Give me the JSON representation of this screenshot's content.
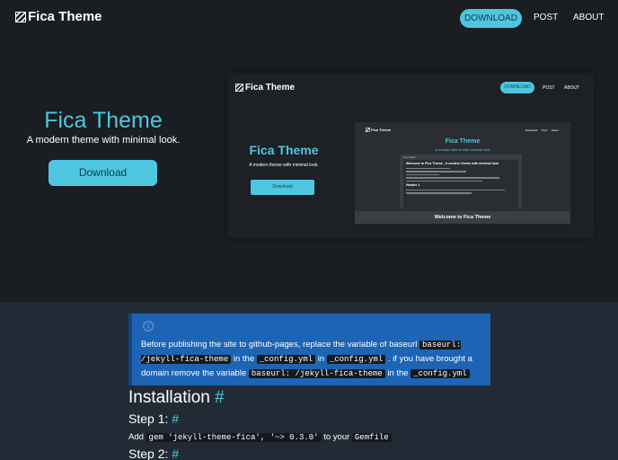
{
  "colors": {
    "accent": "#4fc6e0",
    "page_bg": "#1a1d21",
    "content_bg": "#222b35",
    "alert_bg": "#1d64b5",
    "code_bg": "#15191e"
  },
  "navbar": {
    "logo_icon": "striped-square-logo-icon",
    "brand": "Fica Theme",
    "download": "DOWNLOAD",
    "post": "POST",
    "about": "ABOUT"
  },
  "hero": {
    "title": "Fica Theme",
    "subtitle": "A modern theme with minimal look.",
    "button": "Download"
  },
  "preview": {
    "brand": "Fica Theme",
    "download": "DOWNLOAD",
    "post": "POST",
    "about": "ABOUT",
    "title": "Fica Theme",
    "subtitle": "A modern theme with minimal look.",
    "button": "Download",
    "inner": {
      "brand": "Fica Theme",
      "download": "Download",
      "post": "Post",
      "about": "About",
      "title": "Fica Theme",
      "subtitle": "A modern theme with minimal look",
      "card_header": "Fica Theme",
      "doc_heading": "Welcome to Fica Theme , A modern theme with minimal look",
      "doc_subheading": "Header 1",
      "footer": "Welcome to Fica Theme"
    }
  },
  "alert": {
    "icon": "info-circle-icon",
    "text_1": "Before publishing the site to github-pages, replace the variable of baseurl ",
    "code_1": "baseurl: /jekyll-fica-theme",
    "text_2": " in the ",
    "code_2": "_config.yml",
    "text_3": " in ",
    "code_3": "_config.yml",
    "text_4": " . if you have brought a domain remove the variable ",
    "code_4": "baseurl: /jekyll-fica-theme",
    "text_5": " in the ",
    "code_5": "_config.yml"
  },
  "content": {
    "installation_heading": "Installation",
    "hash": "#",
    "step1_heading": "Step 1:",
    "step1_text_1": "Add ",
    "step1_code_1": "gem 'jekyll-theme-fica', '~> 0.3.0'",
    "step1_text_2": " to your ",
    "step1_code_2": "Gemfile",
    "step2_heading": "Step 2:"
  }
}
